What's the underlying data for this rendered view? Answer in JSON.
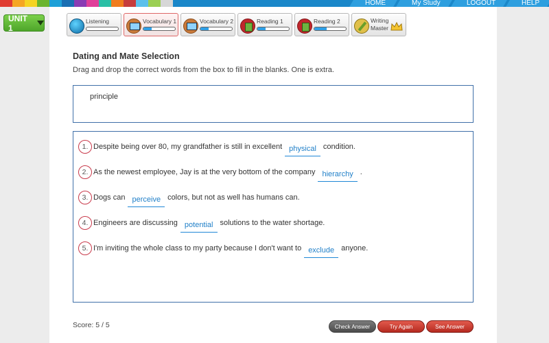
{
  "nav": {
    "stripe_colors": [
      "#e03c31",
      "#f5a623",
      "#f5d423",
      "#6ab42d",
      "#1ea0d8",
      "#1a6fb3",
      "#8a3cb4",
      "#e0409a",
      "#2bbfa6",
      "#f07d1e",
      "#c63d3d",
      "#5bc0eb",
      "#9bcf53",
      "#d7d7d7"
    ],
    "links": [
      "HOME",
      "My Study",
      "LOGOUT",
      "HELP"
    ]
  },
  "unit": {
    "label": "UNIT 1"
  },
  "tabs": [
    {
      "label": "Listening",
      "icon": "music-icon",
      "progress": 0.0
    },
    {
      "label": "Vocabulary 1",
      "icon": "monitor-icon",
      "progress": 0.25
    },
    {
      "label": "Vocabulary 2",
      "icon": "monitor-icon",
      "progress": 0.25
    },
    {
      "label": "Reading 1",
      "icon": "book-icon",
      "progress": 0.25
    },
    {
      "label": "Reading 2",
      "icon": "book-icon",
      "progress": 0.4
    },
    {
      "label_line1": "Writing",
      "label_line2": "Master",
      "icon": "pencil-icon"
    }
  ],
  "activity": {
    "title": "Dating and Mate Selection",
    "instructions": "Drag and drop the correct words from the box to fill in the blanks. One is extra.",
    "word_bank": [
      "principle"
    ],
    "questions": [
      {
        "num": "1.",
        "before": "Despite being over 80, my grandfather is still in excellent",
        "answer": "physical",
        "after": "condition."
      },
      {
        "num": "2.",
        "before": "As the newest employee, Jay is at the very bottom of the company",
        "answer": "hierarchy",
        "after": "."
      },
      {
        "num": "3.",
        "before": "Dogs can",
        "answer": "perceive",
        "after": "colors, but not as well has humans can."
      },
      {
        "num": "4.",
        "before": "Engineers are discussing",
        "answer": "potential",
        "after": "solutions to the water shortage."
      },
      {
        "num": "5.",
        "before": "I'm inviting the whole class to my party because I don't want to",
        "answer": "exclude",
        "after": "anyone."
      }
    ]
  },
  "footer": {
    "score": "Score: 5 / 5",
    "check_label": "Check Answer",
    "retry_label": "Try Again",
    "answer_label": "See Answer"
  },
  "colors": {
    "accent": "#1a87c9",
    "unit_green": "#5cb531",
    "button_red": "#c9372c"
  }
}
